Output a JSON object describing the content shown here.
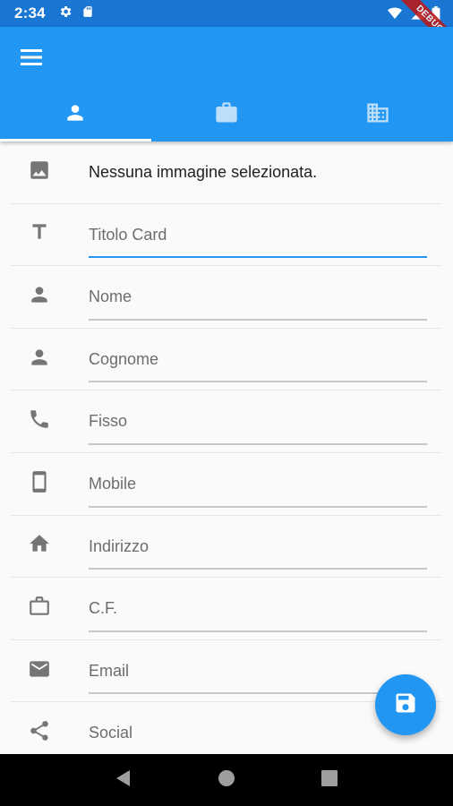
{
  "status_bar": {
    "time": "2:34",
    "left_icons": [
      "gear-icon",
      "sd-card-icon"
    ],
    "right_icons": [
      "wifi-icon",
      "cellular-icon",
      "battery-icon"
    ],
    "debug_banner": "DEBUG"
  },
  "app_bar": {
    "menu_icon": "menu-icon",
    "tabs": [
      {
        "icon": "person-icon",
        "active": true
      },
      {
        "icon": "briefcase-icon",
        "active": false
      },
      {
        "icon": "building-icon",
        "active": false
      }
    ]
  },
  "form": {
    "image_status": "Nessuna immagine selezionata.",
    "fields": {
      "titolo": "Titolo Card",
      "nome": "Nome",
      "cognome": "Cognome",
      "fisso": "Fisso",
      "mobile": "Mobile",
      "indirizzo": "Indirizzo",
      "cf": "C.F.",
      "email": "Email",
      "social": "Social"
    }
  },
  "fab": {
    "icon": "save-icon"
  },
  "nav_bar": {
    "buttons": [
      "back-icon",
      "home-icon",
      "recents-icon"
    ]
  },
  "colors": {
    "primary": "#2196f3",
    "status_bar": "#1976d2",
    "icon_grey": "#757575"
  }
}
